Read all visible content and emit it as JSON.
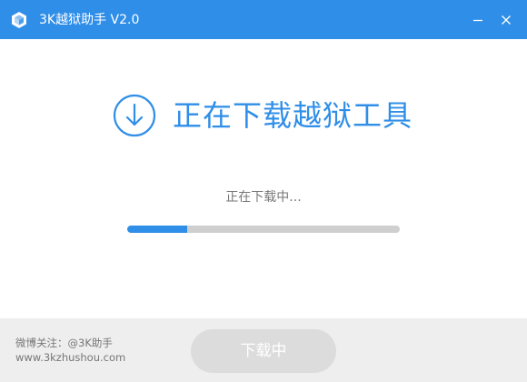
{
  "window": {
    "title": "3K越狱助手 V2.0",
    "logo_icon": "app-logo-icon",
    "minimize_icon": "minimize-icon",
    "close_icon": "close-icon",
    "titlebar_color": "#2f8ee8"
  },
  "main": {
    "heading": "正在下载越狱工具",
    "heading_icon": "download-arrow-circle-icon",
    "status": "正在下载中...",
    "progress_fraction": 0.22,
    "accent_color": "#2f8ee8"
  },
  "footer": {
    "weibo": "微博关注：@3K助手",
    "url": "www.3kzhushou.com",
    "button_label": "下载中",
    "button_disabled": true
  }
}
